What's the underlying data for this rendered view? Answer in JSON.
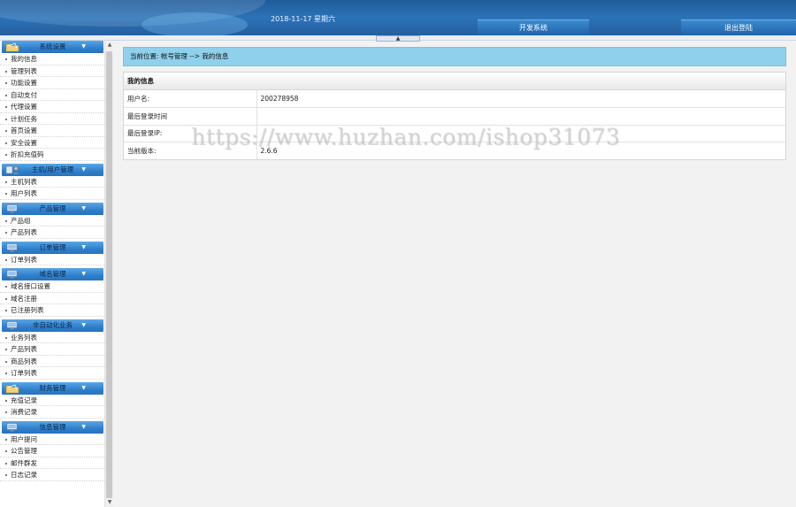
{
  "header": {
    "date": "2018-11-17 星期六",
    "dev_button": "开发系统",
    "logout_button": "退出登陆",
    "collapse_glyph": "▲"
  },
  "sidebar": {
    "groups": [
      {
        "title": "系统设置",
        "icon": "folder-icon",
        "items": [
          "我的信息",
          "管理列表",
          "功能设置",
          "自动支付",
          "代理设置",
          "计划任务",
          "首页设置",
          "安全设置",
          "折扣充值码"
        ]
      },
      {
        "title": "主机/用户管理",
        "icon": "server-user-icon",
        "items": [
          "主机列表",
          "用户列表"
        ]
      },
      {
        "title": "产品管理",
        "icon": "monitor-icon",
        "items": [
          "产品组",
          "产品列表"
        ]
      },
      {
        "title": "订单管理",
        "icon": "monitor-icon",
        "items": [
          "订单列表"
        ]
      },
      {
        "title": "域名管理",
        "icon": "monitor-icon",
        "items": [
          "域名接口设置",
          "域名注册",
          "已注册列表"
        ]
      },
      {
        "title": "非自动化业务",
        "icon": "monitor-icon",
        "items": [
          "业务列表",
          "产品列表",
          "商品列表",
          "订单列表"
        ]
      },
      {
        "title": "财务管理",
        "icon": "folder-icon",
        "items": [
          "充值记录",
          "消费记录"
        ]
      },
      {
        "title": "信息管理",
        "icon": "monitor-icon",
        "items": [
          "用户提问",
          "公告管理",
          "邮件群发",
          "日志记录"
        ]
      }
    ]
  },
  "breadcrumb": "当前位置: 帐号管理 --> 我的信息",
  "panel": {
    "title": "我的信息",
    "rows": [
      {
        "label": "用户名:",
        "value": "200278958"
      },
      {
        "label": "最后登录时间",
        "value": ""
      },
      {
        "label": "最后登录IP:",
        "value": ""
      },
      {
        "label": "当前版本:",
        "value": "2.6.6"
      }
    ]
  },
  "watermark": "https://www.huzhan.com/ishop31073",
  "colors": {
    "header": "#2c73b7",
    "breadcrumb_bg": "#8fd0ec",
    "group_header": "#2f7fcb"
  }
}
